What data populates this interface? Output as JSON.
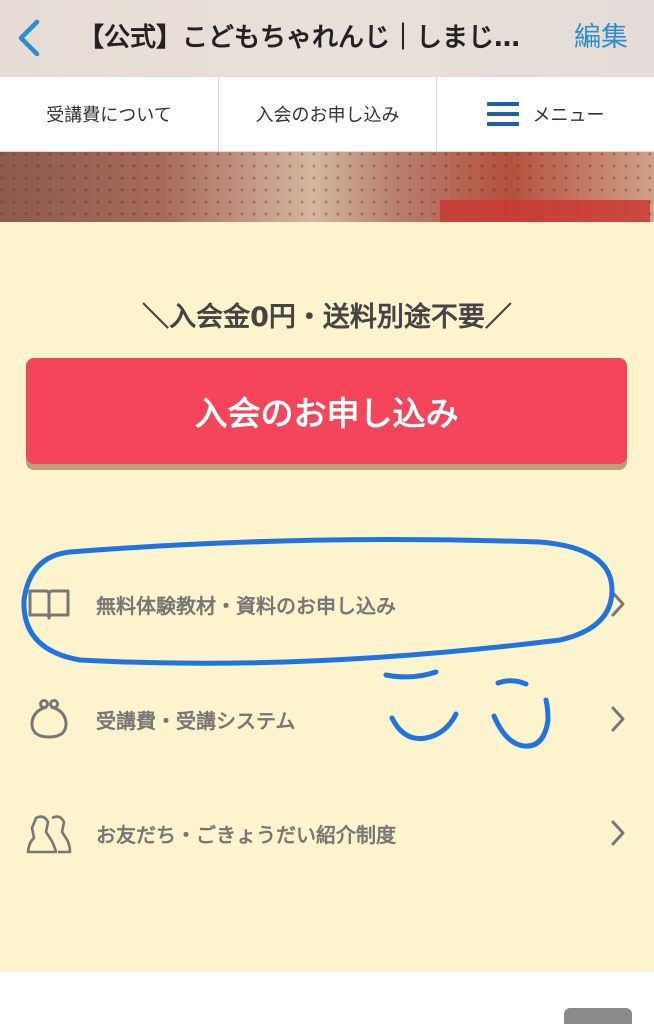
{
  "navbar": {
    "title": "【公式】こどもちゃれんじ｜しまじ…",
    "edit_label": "編集",
    "back_icon": "chevron-left-icon",
    "accent_color": "#2d8ecb"
  },
  "tabs": [
    {
      "label": "受講費について"
    },
    {
      "label": "入会のお申し込み"
    },
    {
      "label": "メニュー",
      "icon": "hamburger-menu-icon"
    }
  ],
  "main": {
    "notice": "＼入会金0円・送料別途不要／",
    "cta_label": "入会のお申し込み",
    "cta_color": "#f4455a",
    "panel_color": "#fdf4cd",
    "links": [
      {
        "label": "無料体験教材・資料のお申し込み",
        "icon": "book-icon"
      },
      {
        "label": "受講費・受講システム",
        "icon": "purse-icon"
      },
      {
        "label": "お友だち・ごきょうだい紹介制度",
        "icon": "people-icon"
      }
    ]
  },
  "annotation": {
    "handwritten_text": "ここ",
    "color": "#1f74e0"
  }
}
